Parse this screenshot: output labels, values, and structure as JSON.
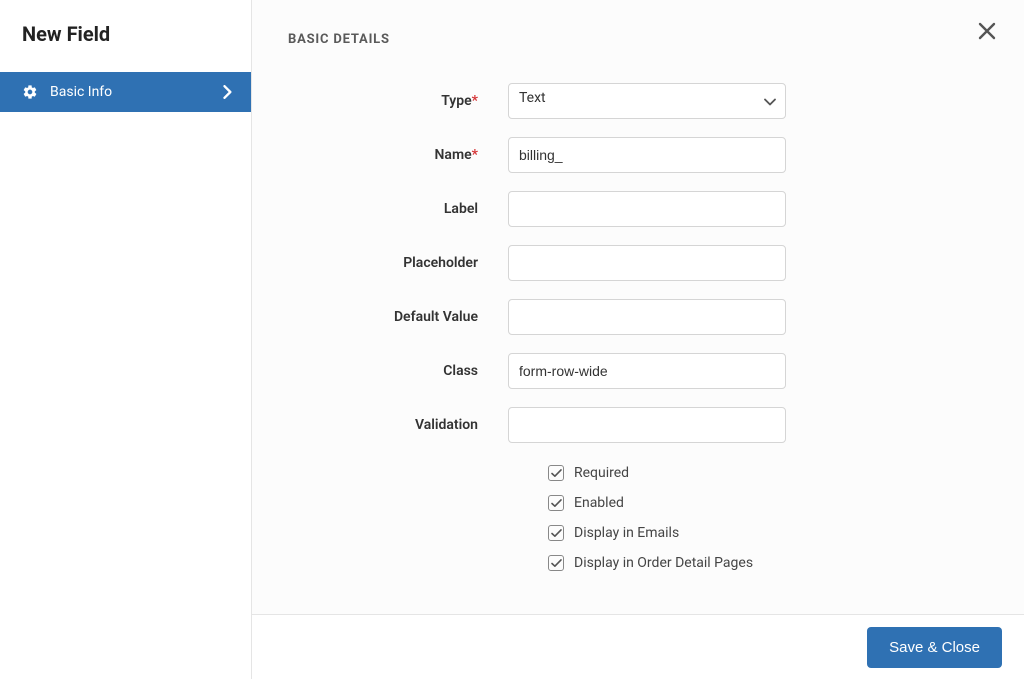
{
  "sidebar": {
    "title": "New Field",
    "item_label": "Basic Info"
  },
  "main": {
    "section_title": "BASIC DETAILS",
    "fields": {
      "type": {
        "label": "Type",
        "value": "Text",
        "required": true
      },
      "name": {
        "label": "Name",
        "value": "billing_",
        "required": true
      },
      "label": {
        "label": "Label",
        "value": "",
        "required": false
      },
      "placeholder": {
        "label": "Placeholder",
        "value": "",
        "required": false
      },
      "default": {
        "label": "Default Value",
        "value": "",
        "required": false
      },
      "class": {
        "label": "Class",
        "value": "form-row-wide",
        "required": false
      },
      "validation": {
        "label": "Validation",
        "value": "",
        "required": false
      }
    },
    "checkboxes": {
      "required": {
        "label": "Required",
        "checked": true
      },
      "enabled": {
        "label": "Enabled",
        "checked": true
      },
      "display_emails": {
        "label": "Display in Emails",
        "checked": true
      },
      "display_order": {
        "label": "Display in Order Detail Pages",
        "checked": true
      }
    }
  },
  "footer": {
    "save_label": "Save & Close"
  }
}
